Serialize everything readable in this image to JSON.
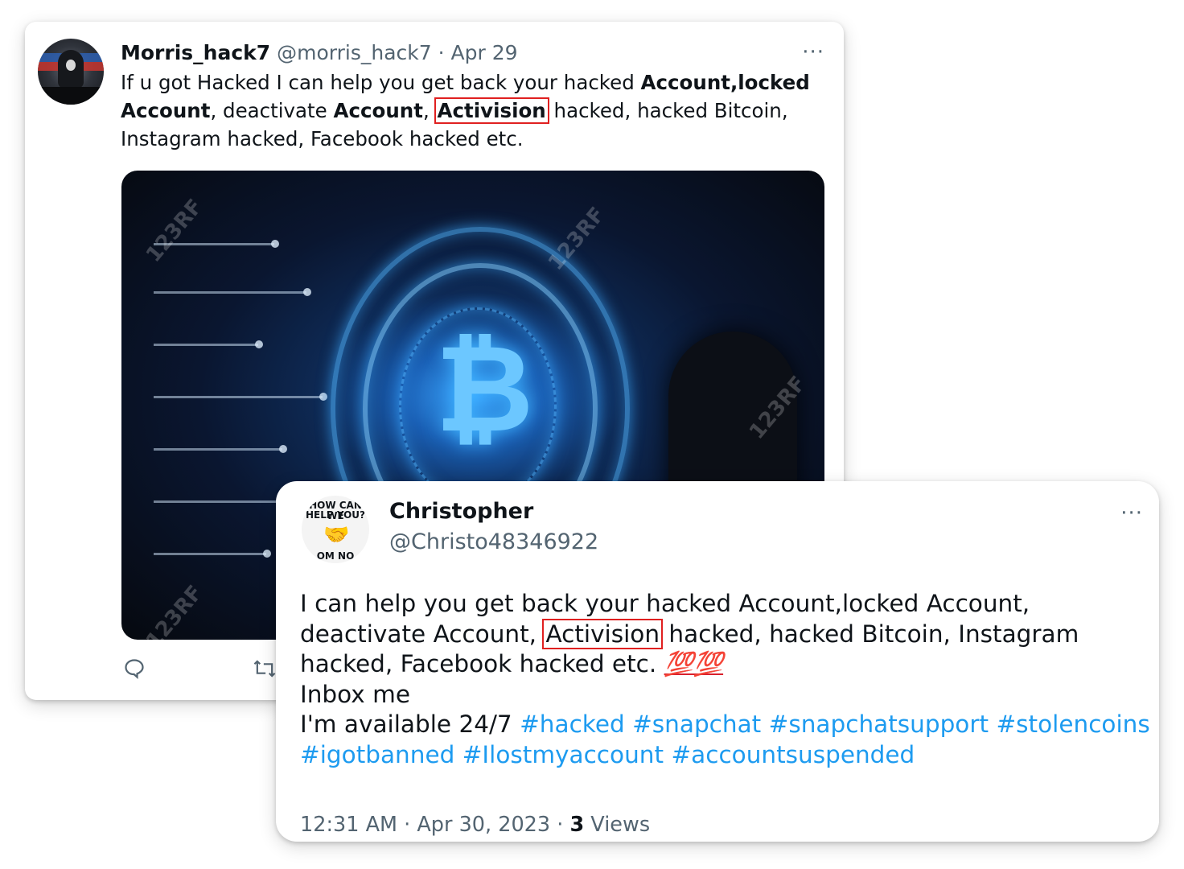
{
  "tweet1": {
    "display_name": "Morris_hack7",
    "handle": "@morris_hack7",
    "date": "Apr 29",
    "more_label": "···",
    "text": {
      "s1": "If u got Hacked I can help you get back your hacked ",
      "b1": "Account,locked",
      "s2": " ",
      "b2": "Account",
      "s3": ", deactivate ",
      "b3": "Account",
      "s4": ", ",
      "b4": "Activision",
      "s5": " hacked, hacked Bitcoin, Instagram hacked, Facebook hacked etc."
    },
    "media": {
      "watermark": "123RF"
    }
  },
  "tweet2": {
    "display_name": "Christopher",
    "handle": "@Christo48346922",
    "more_label": "···",
    "avatar": {
      "line1": "HOW CAN WE",
      "line2": "HELP YOU?",
      "line3": "OM NO"
    },
    "text": {
      "s1": "I can help you get back your hacked Account,locked Account, deactivate Account, ",
      "hl": "Activision",
      "s2": " hacked, hacked Bitcoin, Instagram hacked, Facebook hacked etc. ",
      "emoji": "💯💯",
      "line2": "Inbox me",
      "line3": "I'm available 24/7 "
    },
    "hashtags": [
      "#hacked",
      "#snapchat",
      "#snapchatsupport",
      "#stolencoins",
      "#igotbanned",
      "#Ilostmyaccount",
      "#accountsuspended"
    ],
    "timestamp": "12:31 AM · Apr 30, 2023 · ",
    "views_count": "3",
    "views_label": " Views"
  },
  "colors": {
    "link": "#1d9bf0",
    "highlight": "#e02020",
    "meta": "#536471"
  }
}
